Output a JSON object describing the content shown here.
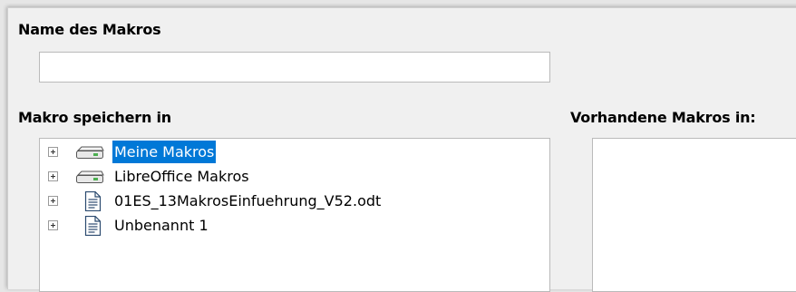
{
  "dialog": {
    "name_label": "Name des Makros",
    "name_value": "",
    "save_in_label": "Makro speichern in",
    "existing_label": "Vorhandene Makros in:",
    "tree": [
      {
        "label": "Meine Makros",
        "icon": "drive-icon",
        "selected": true,
        "expandable": true
      },
      {
        "label": "LibreOffice Makros",
        "icon": "drive-icon",
        "selected": false,
        "expandable": true
      },
      {
        "label": "01ES_13MakrosEinfuehrung_V52.odt",
        "icon": "document-icon",
        "selected": false,
        "expandable": true
      },
      {
        "label": "Unbenannt 1",
        "icon": "document-icon",
        "selected": false,
        "expandable": true
      }
    ]
  },
  "colors": {
    "selection": "#0078d7",
    "background": "#f0f0f0"
  }
}
